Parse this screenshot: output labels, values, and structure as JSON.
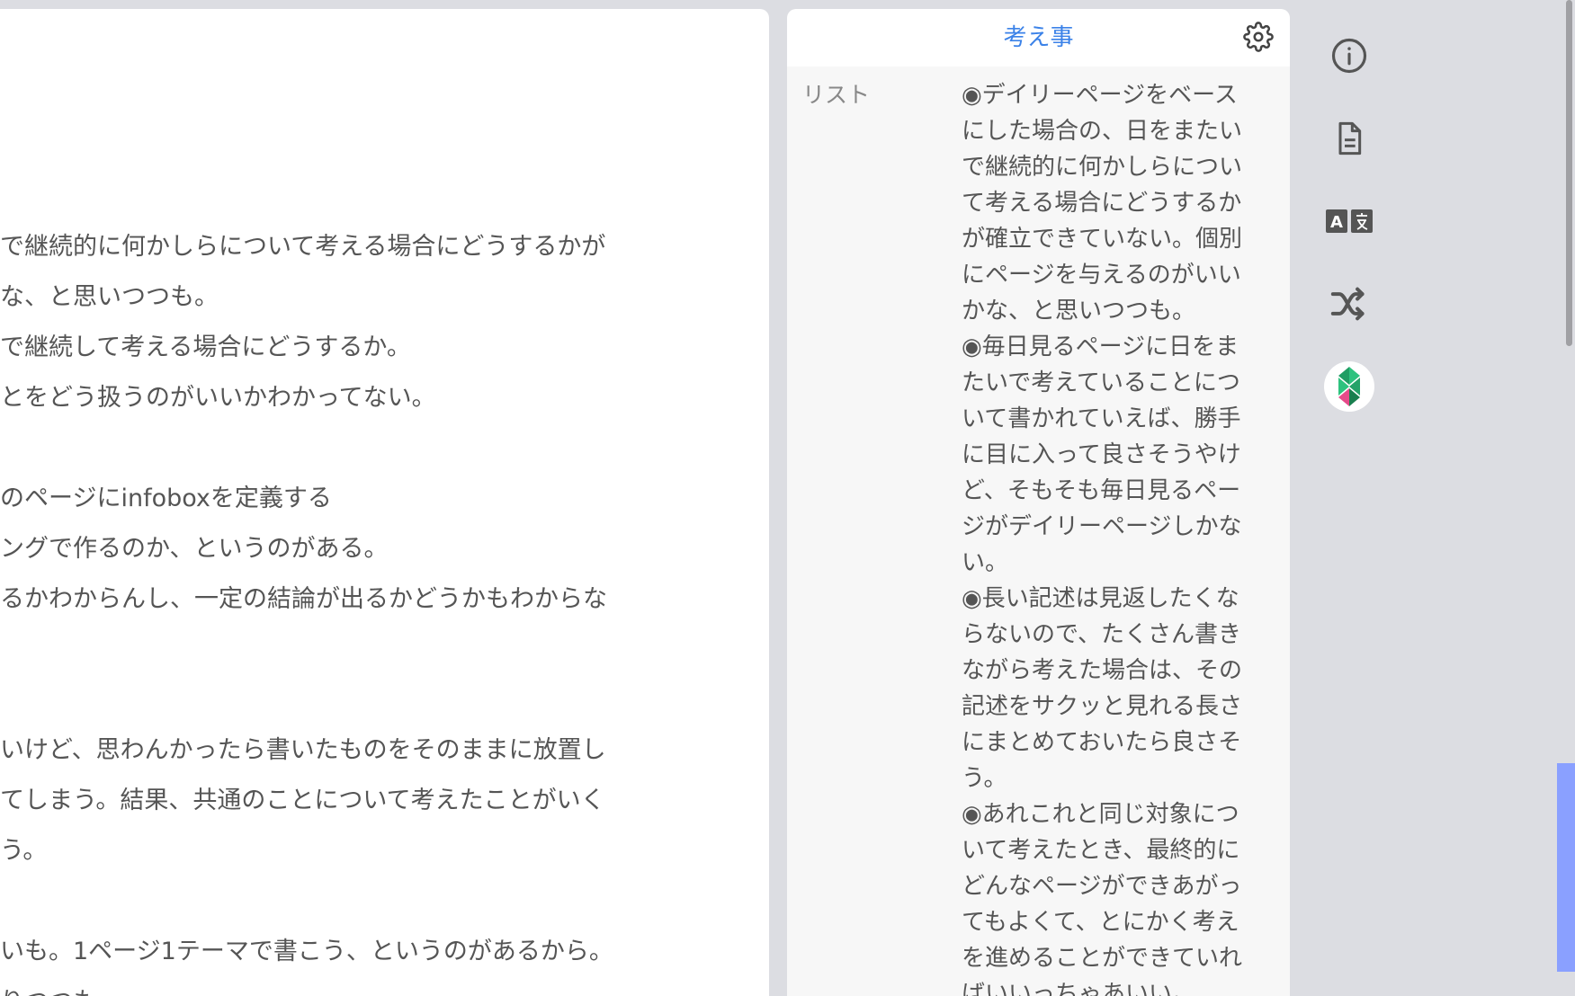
{
  "main": {
    "lines": [
      "で継続的に何かしらについて考える場合にどうするかが",
      "な、と思いつつも。",
      "で継続して考える場合にどうするか。",
      "とをどう扱うのがいいかわかってない。",
      "",
      "のページにinfoboxを定義する",
      "ングで作るのか、というのがある。",
      "るかわからんし、一定の結論が出るかどうかもわからな",
      "",
      "",
      "いけど、思わんかったら書いたものをそのままに放置し",
      "てしまう。結果、共通のことについて考えたことがいく",
      "う。",
      "",
      "いも。1ページ1テーマで書こう、というのがあるから。",
      "りつつも"
    ]
  },
  "infobox": {
    "title": "考え事",
    "key": "リスト",
    "value_lines": [
      "◉デイリーページをベース",
      "にした場合の、日をまたい",
      "で継続的に何かしらについ",
      "て考える場合にどうするか",
      "が確立できていない。個別",
      "にページを与えるのがいい",
      "かな、と思いつつも。",
      "◉毎日見るページに日をま",
      "たいで考えていることにつ",
      "いて書かれていえば、勝手",
      "に目に入って良さそうやけ",
      "ど、そもそも毎日見るペー",
      "ジがデイリーページしかな",
      "い。",
      "◉長い記述は見返したくな",
      "らないので、たくさん書き",
      "ながら考えた場合は、その",
      "記述をサクッと見れる長さ",
      "にまとめておいたら良さそ",
      "う。",
      "◉あれこれと同じ対象につ",
      "いて考えたとき、最終的に",
      "どんなページができあがっ",
      "てもよくて、とにかく考え",
      "を進めることができていれ",
      "ばいいっちゃあいい。"
    ]
  },
  "toolbar": {
    "icons": [
      "info-icon",
      "document-icon",
      "translate-icon",
      "shuffle-icon",
      "app-logo-icon"
    ]
  },
  "colors": {
    "accent": "#3b82e8",
    "background": "#dcdde2",
    "panel": "#ffffff",
    "infobox_bg": "#f7f7f7",
    "marker": "#8aa0ff"
  }
}
